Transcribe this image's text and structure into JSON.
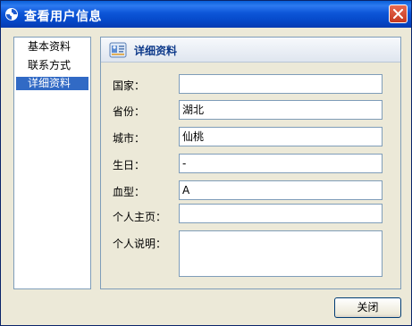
{
  "window": {
    "title": "查看用户信息",
    "close_icon": "close-icon",
    "app_icon": "app-icon"
  },
  "sidebar": {
    "items": [
      {
        "label": "基本资料",
        "selected": false
      },
      {
        "label": "联系方式",
        "selected": false
      },
      {
        "label": "详细资料",
        "selected": true
      }
    ]
  },
  "detail": {
    "header_icon": "contact-card-icon",
    "header_title": "详细资料",
    "fields": [
      {
        "label": "国家：",
        "value": ""
      },
      {
        "label": "省份：",
        "value": "湖北"
      },
      {
        "label": "城市：",
        "value": "仙桃"
      },
      {
        "label": "生日：",
        "value": "-"
      },
      {
        "label": "血型：",
        "value": "A"
      },
      {
        "label": "个人主页：",
        "value": ""
      },
      {
        "label": "个人说明：",
        "value": ""
      }
    ]
  },
  "footer": {
    "close_label": "关闭"
  },
  "colors": {
    "titlebar": "#0548c8",
    "selection": "#316ac5",
    "panel_border": "#7f9db9",
    "header_title": "#0e3a8a"
  }
}
